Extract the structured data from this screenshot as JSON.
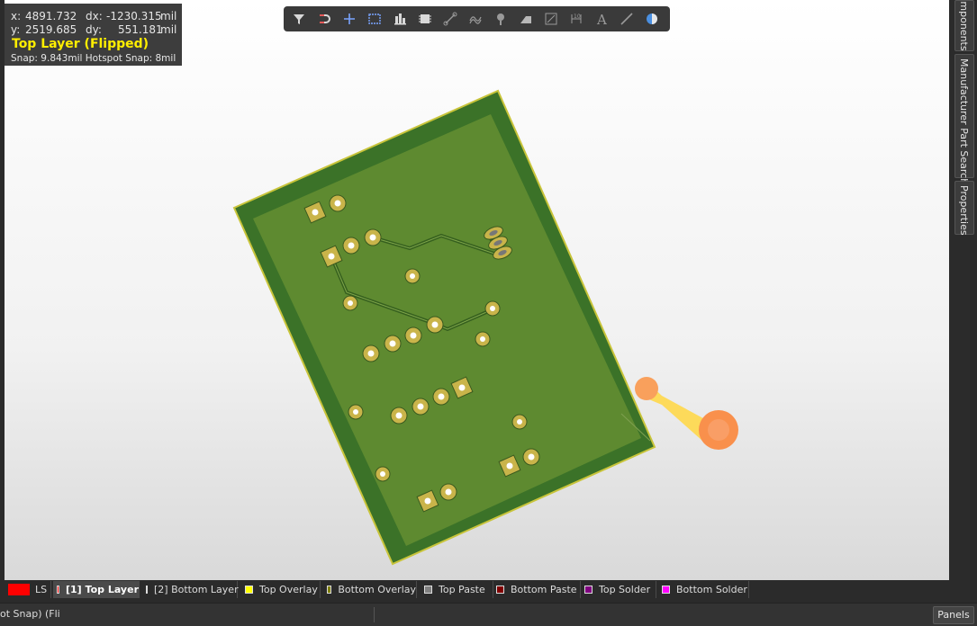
{
  "coords": {
    "x_label": "x:",
    "x_value": "4891.732",
    "dx_label": "dx:",
    "dx_value": "-1230.315",
    "x_unit": "mil",
    "y_label": "y:",
    "y_value": "2519.685",
    "dy_label": "dy:",
    "dy_value": "551.181",
    "y_unit": "mil",
    "layer_name": "Top Layer (Flipped)",
    "snap_text": "Snap: 9.843mil Hotspot Snap: 8mil"
  },
  "toolbar": {
    "icons": [
      "filter-icon",
      "interactive-route-icon",
      "place-cross-icon",
      "select-area-icon",
      "align-icon",
      "component-icon",
      "net-icon",
      "diff-pair-icon",
      "via-icon",
      "polygon-icon",
      "region-icon",
      "dimension-icon",
      "text-icon",
      "line-icon",
      "3d-body-icon"
    ]
  },
  "right_panels": {
    "components": "Components",
    "part_search": "Manufacturer Part Search",
    "properties": "Properties"
  },
  "layers": {
    "ls_label": "LS",
    "tabs": [
      {
        "label": "[1] Top Layer",
        "color": "#ff0000",
        "active": true
      },
      {
        "label": "[2] Bottom Layer",
        "color": "#0000ff",
        "active": false
      },
      {
        "label": "Top Overlay",
        "color": "#ffff00",
        "active": false
      },
      {
        "label": "Bottom Overlay",
        "color": "#808000",
        "active": false
      },
      {
        "label": "Top Paste",
        "color": "#808080",
        "active": false
      },
      {
        "label": "Bottom Paste",
        "color": "#800000",
        "active": false
      },
      {
        "label": "Top Solder",
        "color": "#800080",
        "active": false
      },
      {
        "label": "Bottom Solder",
        "color": "#ff00ff",
        "active": false
      }
    ]
  },
  "status": {
    "text": "ot Snap) (Flip",
    "panels_label": "Panels"
  },
  "colors": {
    "board": "#5c8a2c",
    "board_edge": "#2f6a25",
    "copper_pad": "#c9b44a",
    "accent_yellow": "#ffee00"
  }
}
